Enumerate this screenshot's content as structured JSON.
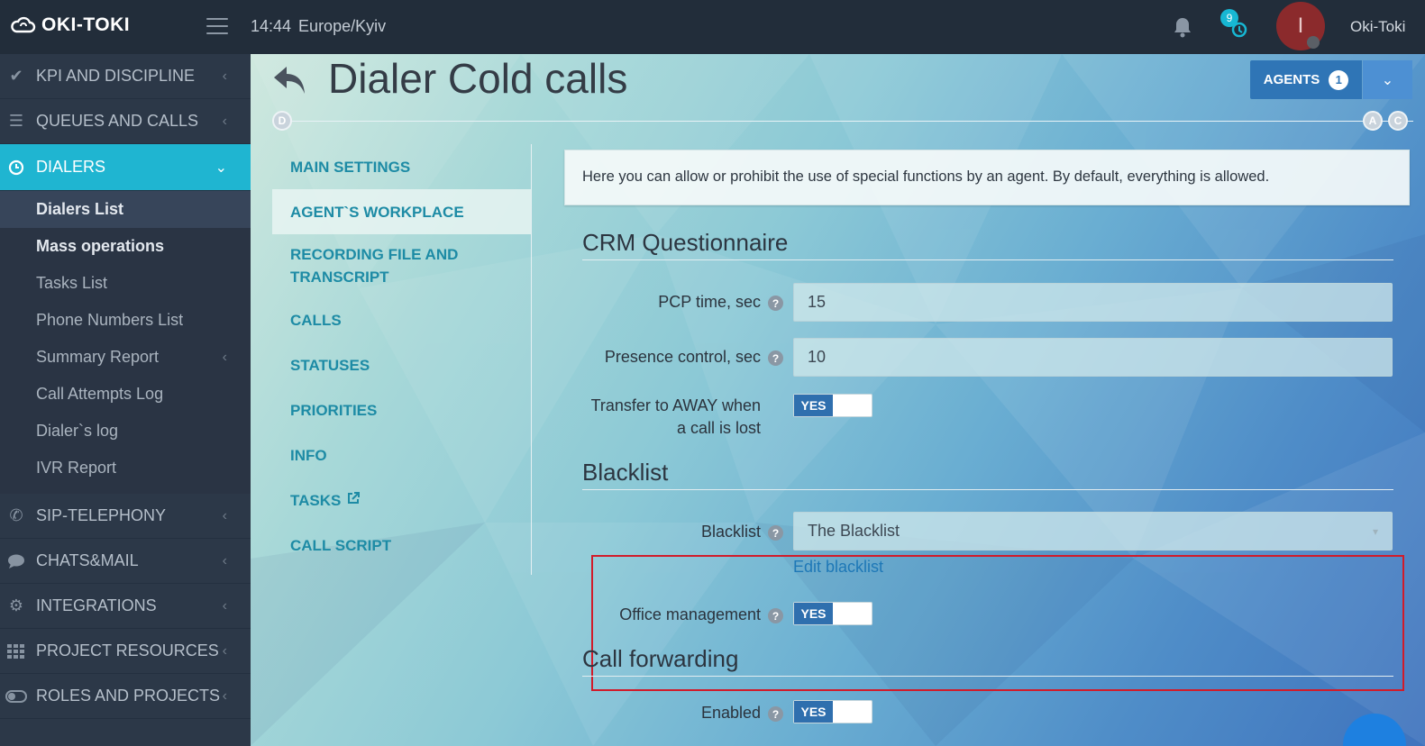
{
  "header": {
    "logo_text": "OKI-TOKI",
    "time": "14:44",
    "timezone": "Europe/Kyiv",
    "notifications_badge": "9",
    "avatar_initial": "I",
    "username": "Oki-Toki"
  },
  "sidebar": {
    "items": [
      {
        "label": "KPI AND DISCIPLINE",
        "icon": "check-icon"
      },
      {
        "label": "QUEUES AND CALLS",
        "icon": "list-icon"
      },
      {
        "label": "DIALERS",
        "icon": "clock-icon"
      },
      {
        "label": "SIP-TELEPHONY",
        "icon": "phone-icon"
      },
      {
        "label": "CHATS&MAIL",
        "icon": "chat-icon"
      },
      {
        "label": "INTEGRATIONS",
        "icon": "gears-icon"
      },
      {
        "label": "PROJECT RESOURCES",
        "icon": "grid-icon"
      },
      {
        "label": "ROLES AND PROJECTS",
        "icon": "toggle-icon"
      }
    ],
    "dialers_sub": [
      {
        "label": "Dialers List"
      },
      {
        "label": "Mass operations"
      },
      {
        "label": "Tasks List"
      },
      {
        "label": "Phone Numbers List"
      },
      {
        "label": "Summary Report"
      },
      {
        "label": "Call Attempts Log"
      },
      {
        "label": "Dialer`s log"
      },
      {
        "label": "IVR Report"
      }
    ]
  },
  "page": {
    "title": "Dialer Cold calls",
    "agents_label": "AGENTS",
    "agents_count": "1",
    "timeline_start": "D",
    "timeline_end_a": "A",
    "timeline_end_c": "C"
  },
  "tabs": [
    {
      "label": "MAIN SETTINGS"
    },
    {
      "label": "AGENT`S WORKPLACE"
    },
    {
      "label": "RECORDING FILE AND TRANSCRIPT"
    },
    {
      "label": "CALLS"
    },
    {
      "label": "STATUSES"
    },
    {
      "label": "PRIORITIES"
    },
    {
      "label": "INFO"
    },
    {
      "label": "TASKS"
    },
    {
      "label": "CALL SCRIPT"
    }
  ],
  "form": {
    "info_text": "Here you can allow or prohibit the use of special functions by an agent. By default, everything is allowed.",
    "crm_title": "CRM Questionnaire",
    "pcp_label": "PCP time, sec",
    "pcp_value": "15",
    "presence_label": "Presence control, sec",
    "presence_value": "10",
    "transfer_label_1": "Transfer to AWAY when",
    "transfer_label_2": "a call is lost",
    "yes": "YES",
    "blacklist_title": "Blacklist",
    "blacklist_label": "Blacklist",
    "blacklist_value": "The Blacklist",
    "edit_blacklist": "Edit blacklist",
    "office_label": "Office management",
    "forwarding_title": "Call forwarding",
    "enabled_label": "Enabled"
  },
  "colors": {
    "accent": "#1fb5d1",
    "primary": "#2f75b6",
    "highlight": "#d11b2a"
  }
}
